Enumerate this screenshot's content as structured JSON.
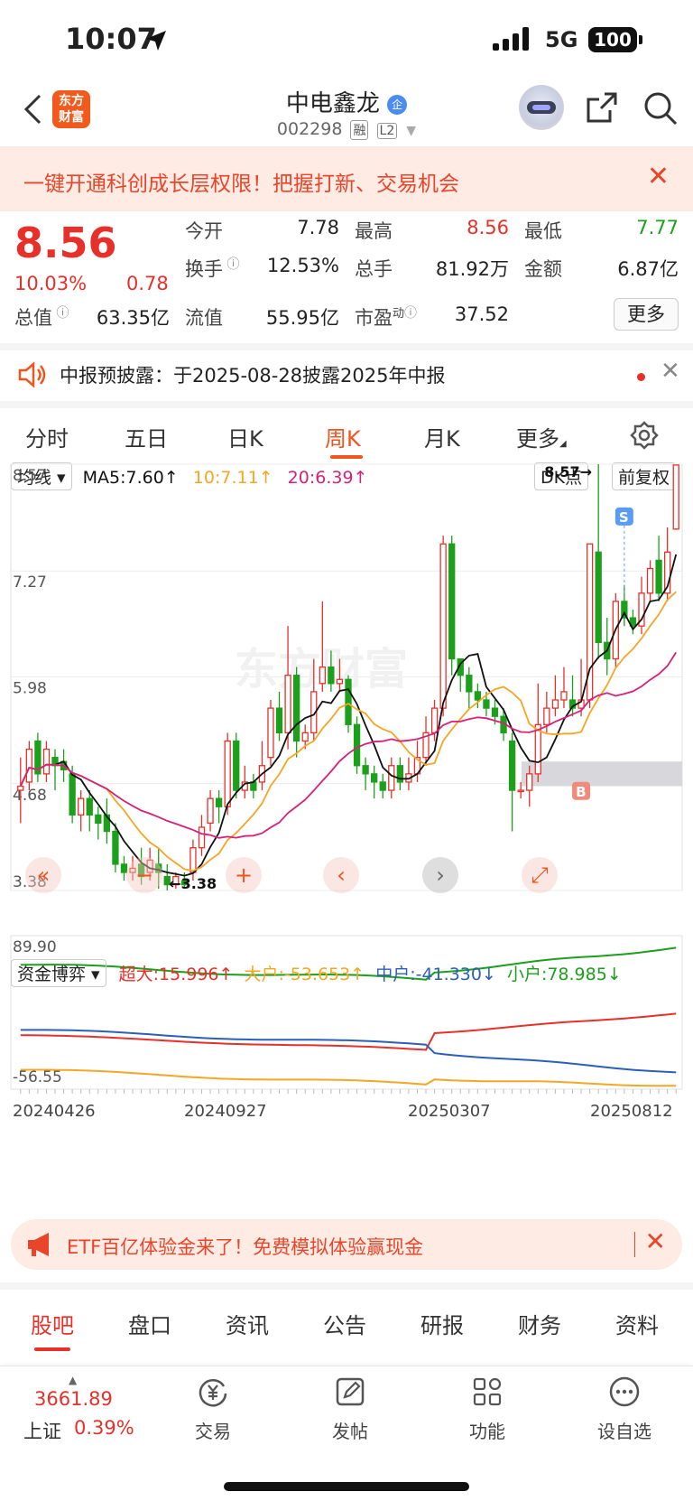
{
  "status_bar": {
    "time": "10:07",
    "network": "5G",
    "battery": "100"
  },
  "header": {
    "logo_line1": "东方",
    "logo_line2": "财富",
    "stock_name": "中电鑫龙",
    "badge": "企",
    "stock_code": "002298",
    "tag1": "融",
    "tag2": "L2"
  },
  "banner": {
    "text": "一键开通科创成长层权限！把握打新、交易机会"
  },
  "quote": {
    "price": "8.56",
    "change_pct": "10.03%",
    "change": "0.78",
    "fields": [
      {
        "label": "今开",
        "value": "7.78",
        "color": "default"
      },
      {
        "label": "最高",
        "value": "8.56",
        "color": "red"
      },
      {
        "label": "最低",
        "value": "7.77",
        "color": "green"
      },
      {
        "label": "换手",
        "value": "12.53%",
        "color": "default"
      },
      {
        "label": "总手",
        "value": "81.92万",
        "color": "default"
      },
      {
        "label": "金额",
        "value": "6.87亿",
        "color": "default"
      },
      {
        "label": "总值",
        "value": "63.35亿",
        "color": "default"
      },
      {
        "label": "流值",
        "value": "55.95亿",
        "color": "default"
      },
      {
        "label": "市盈",
        "label_sup": "动",
        "value": "37.52",
        "color": "default"
      }
    ],
    "more_label": "更多"
  },
  "notice": {
    "text": "中报预披露：于2025-08-28披露2025年中报"
  },
  "period_tabs": [
    "分时",
    "五日",
    "日K",
    "周K",
    "月K",
    "更多"
  ],
  "active_period": "周K",
  "chart_header": {
    "indicator": "均线",
    "ma5": "MA5:7.60",
    "ma10": "10:7.11",
    "ma20": "20:6.39",
    "dk": "DK点",
    "fq": "前复权"
  },
  "fund_header": {
    "indicator": "资金博弈",
    "super": "超大:15.996",
    "large": "大户:-53.653",
    "mid": "中户:-41.330",
    "small": "小户:78.985"
  },
  "chart_data": {
    "type": "candlestick",
    "price_axis": {
      "ticks": [
        "8.57",
        "7.27",
        "5.98",
        "4.68",
        "3.38"
      ],
      "ylim": [
        3.38,
        8.57
      ]
    },
    "annotations": {
      "high": "8.57",
      "low": "3.38",
      "buy_marker": "B",
      "sell_marker": "S"
    },
    "candles": [
      [
        4.6,
        4.65,
        4.2,
        5.0
      ],
      [
        4.7,
        5.1,
        4.6,
        5.2
      ],
      [
        5.2,
        4.8,
        4.7,
        5.3
      ],
      [
        4.8,
        5.1,
        4.7,
        5.2
      ],
      [
        5.0,
        4.9,
        4.6,
        5.1
      ],
      [
        4.95,
        4.85,
        4.7,
        5.1
      ],
      [
        4.8,
        4.3,
        4.2,
        4.9
      ],
      [
        4.3,
        4.5,
        4.1,
        4.6
      ],
      [
        4.5,
        4.3,
        4.1,
        4.6
      ],
      [
        4.3,
        4.2,
        4.0,
        4.4
      ],
      [
        4.3,
        4.1,
        3.95,
        4.5
      ],
      [
        4.1,
        3.7,
        3.6,
        4.2
      ],
      [
        3.7,
        3.6,
        3.5,
        3.8
      ],
      [
        3.6,
        3.65,
        3.5,
        3.8
      ],
      [
        3.7,
        3.55,
        3.45,
        3.9
      ],
      [
        3.6,
        3.75,
        3.5,
        3.9
      ],
      [
        3.7,
        3.6,
        3.4,
        3.9
      ],
      [
        3.55,
        3.45,
        3.38,
        3.7
      ],
      [
        3.45,
        3.55,
        3.4,
        3.6
      ],
      [
        3.5,
        3.45,
        3.42,
        3.6
      ],
      [
        3.6,
        3.9,
        3.5,
        4.0
      ],
      [
        3.9,
        4.15,
        3.8,
        4.3
      ],
      [
        4.2,
        4.5,
        4.1,
        4.6
      ],
      [
        4.5,
        4.4,
        4.2,
        4.6
      ],
      [
        4.4,
        5.2,
        4.3,
        5.3
      ],
      [
        5.2,
        4.6,
        4.5,
        5.3
      ],
      [
        4.6,
        4.7,
        4.5,
        4.9
      ],
      [
        4.7,
        4.6,
        4.5,
        4.8
      ],
      [
        4.7,
        4.9,
        4.6,
        5.2
      ],
      [
        5.0,
        5.6,
        4.9,
        5.7
      ],
      [
        5.6,
        5.3,
        5.2,
        5.8
      ],
      [
        5.3,
        6.0,
        5.1,
        6.6
      ],
      [
        6.0,
        5.2,
        5.0,
        6.1
      ],
      [
        5.2,
        5.3,
        5.1,
        5.4
      ],
      [
        5.3,
        5.8,
        5.2,
        6.2
      ],
      [
        5.9,
        6.1,
        5.8,
        6.9
      ],
      [
        6.1,
        5.9,
        5.8,
        6.3
      ],
      [
        5.9,
        5.95,
        5.8,
        6.2
      ],
      [
        5.95,
        5.4,
        5.3,
        6.0
      ],
      [
        5.4,
        4.9,
        4.8,
        5.5
      ],
      [
        4.9,
        4.8,
        4.6,
        5.0
      ],
      [
        4.8,
        4.7,
        4.5,
        4.9
      ],
      [
        4.7,
        4.6,
        4.5,
        4.8
      ],
      [
        4.6,
        4.9,
        4.5,
        5.0
      ],
      [
        4.9,
        4.7,
        4.6,
        5.0
      ],
      [
        4.7,
        4.8,
        4.6,
        5.0
      ],
      [
        4.8,
        5.0,
        4.7,
        5.2
      ],
      [
        5.0,
        5.3,
        4.9,
        5.5
      ],
      [
        5.3,
        5.6,
        5.2,
        5.7
      ],
      [
        5.6,
        7.6,
        5.5,
        7.7
      ],
      [
        7.6,
        6.2,
        6.0,
        7.7
      ],
      [
        6.2,
        6.0,
        5.8,
        6.2
      ],
      [
        6.0,
        5.8,
        5.6,
        6.1
      ],
      [
        5.8,
        5.7,
        5.6,
        5.9
      ],
      [
        5.7,
        5.6,
        5.5,
        5.8
      ],
      [
        5.6,
        5.5,
        5.4,
        5.7
      ],
      [
        5.5,
        5.3,
        5.2,
        5.6
      ],
      [
        5.2,
        4.6,
        4.1,
        5.3
      ],
      [
        4.6,
        4.6,
        4.5,
        4.7
      ],
      [
        4.6,
        4.8,
        4.4,
        4.9
      ],
      [
        4.8,
        5.4,
        4.7,
        5.9
      ],
      [
        5.4,
        5.6,
        5.3,
        5.8
      ],
      [
        5.6,
        5.7,
        5.5,
        6.0
      ],
      [
        5.7,
        5.8,
        5.6,
        6.1
      ],
      [
        5.7,
        5.6,
        5.5,
        6.0
      ],
      [
        5.6,
        5.7,
        5.5,
        6.2
      ],
      [
        5.7,
        7.6,
        5.6,
        7.6
      ],
      [
        7.5,
        6.4,
        6.2,
        8.57
      ],
      [
        6.4,
        6.2,
        6.0,
        6.7
      ],
      [
        6.2,
        6.9,
        6.1,
        7.0
      ],
      [
        6.9,
        6.7,
        6.6,
        7.1
      ],
      [
        6.7,
        6.6,
        6.5,
        6.8
      ],
      [
        6.6,
        7.0,
        6.5,
        7.2
      ],
      [
        7.0,
        7.3,
        6.9,
        7.4
      ],
      [
        7.4,
        7.0,
        6.9,
        7.7
      ],
      [
        7.0,
        7.5,
        6.9,
        7.8
      ],
      [
        7.78,
        8.56,
        7.77,
        8.56
      ]
    ],
    "fund_axis": {
      "ticks": [
        "89.90",
        "-56.55"
      ],
      "ylim": [
        -56.55,
        89.9
      ]
    },
    "x_ticks": [
      "20240426",
      "20240927",
      "20250307",
      "20250812"
    ]
  },
  "chart_controls": [
    "prev-fast",
    "zoom-out",
    "zoom-in",
    "prev",
    "next",
    "fullscreen"
  ],
  "ad_banner": {
    "text": "ETF百亿体验金来了！免费模拟体验赢现金"
  },
  "bottom_tabs": [
    "股吧",
    "盘口",
    "资讯",
    "公告",
    "研报",
    "财务",
    "资料"
  ],
  "active_bottom_tab": "股吧",
  "bottom_nav": {
    "index_value": "3661.89",
    "index_name": "上证",
    "index_pct": "0.39%",
    "items": [
      "交易",
      "发帖",
      "功能",
      "设自选"
    ]
  },
  "colors": {
    "up": "#e8302a",
    "down": "#1ca01c",
    "brand": "#f2541d",
    "ma5": "#111111",
    "ma10": "#f5a623",
    "ma20": "#d6217a",
    "mid": "#2b5fb8"
  }
}
